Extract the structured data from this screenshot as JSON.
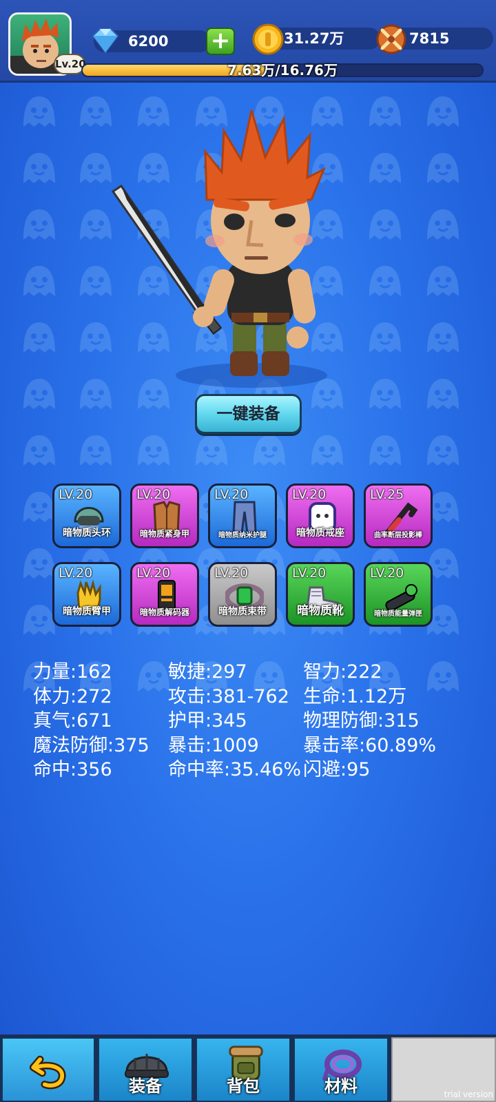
{
  "header": {
    "level_badge": "Lv.20",
    "gems": "6200",
    "add_button": "+",
    "coins": "31.27万",
    "combat_power": "7815",
    "xp_text": "7.63万/16.76万",
    "xp_progress": 0.455
  },
  "hero": {
    "equip_all_label": "一键装备"
  },
  "equipment": [
    {
      "level": "LV.20",
      "name": "暗物质头环",
      "quality": "blue",
      "icon": "helmet-icon"
    },
    {
      "level": "LV.20",
      "name": "暗物质紧身甲",
      "quality": "purple",
      "icon": "armor-icon"
    },
    {
      "level": "LV.20",
      "name": "暗物质纳米护腿",
      "quality": "blue",
      "icon": "leggings-icon"
    },
    {
      "level": "LV.20",
      "name": "暗物质戒座",
      "quality": "purple",
      "icon": "ring-icon"
    },
    {
      "level": "LV.25",
      "name": "曲率断层投影棒",
      "quality": "purple",
      "icon": "crowbar-icon"
    },
    {
      "level": "LV.20",
      "name": "暗物质臂甲",
      "quality": "blue",
      "icon": "glove-icon"
    },
    {
      "level": "LV.20",
      "name": "暗物质解码器",
      "quality": "purple",
      "icon": "decoder-icon"
    },
    {
      "level": "LV.20",
      "name": "暗物质束带",
      "quality": "grey",
      "icon": "belt-icon"
    },
    {
      "level": "LV.20",
      "name": "暗物质靴",
      "quality": "green",
      "icon": "boots-icon"
    },
    {
      "level": "LV.20",
      "name": "暗物质能量弹匣",
      "quality": "green",
      "icon": "launcher-icon"
    }
  ],
  "stats": [
    "力量:162",
    "敏捷:297",
    "智力:222",
    "体力:272",
    "攻击:381-762",
    "生命:1.12万",
    "真气:671",
    "护甲:345",
    "物理防御:315",
    "魔法防御:375",
    "暴击:1009",
    "暴击率:60.89%",
    "命中:356",
    "命中率:35.46%",
    "闪避:95"
  ],
  "bottom_nav": {
    "back_icon": "back-arrow-icon",
    "tabs": [
      {
        "label": "装备",
        "icon": "helmet-icon"
      },
      {
        "label": "背包",
        "icon": "backpack-icon"
      },
      {
        "label": "材料",
        "icon": "rope-icon"
      }
    ]
  },
  "watermark": "trial version",
  "colors": {
    "background": "#2a72ea",
    "top_bar": "#2448a4",
    "quality_blue": "#1c69d8",
    "quality_purple": "#b52ac0",
    "quality_green": "#1d9326",
    "quality_grey": "#8f8f8f",
    "equip_button": "#62d8ef"
  }
}
